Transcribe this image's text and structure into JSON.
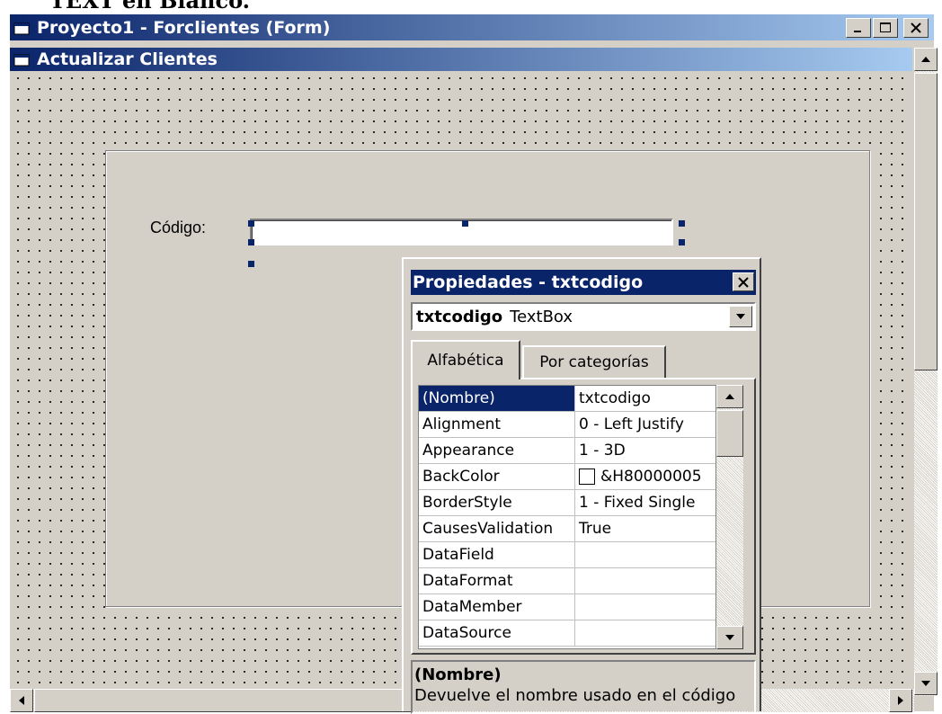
{
  "cropped_caption": "TEXT en Blanco.",
  "window": {
    "title": "Proyecto1 - Forclientes (Form)",
    "minimize": "_",
    "close": "×"
  },
  "form": {
    "caption": "Actualizar Clientes",
    "codigo_label": "Código:",
    "textbox_value": ""
  },
  "properties": {
    "title": "Propiedades - txtcodigo",
    "object_name": "txtcodigo",
    "object_type": "TextBox",
    "tabs": [
      "Alfabética",
      "Por categorías"
    ],
    "rows": [
      {
        "name": "(Nombre)",
        "value": "txtcodigo"
      },
      {
        "name": "Alignment",
        "value": "0 - Left Justify"
      },
      {
        "name": "Appearance",
        "value": "1 - 3D"
      },
      {
        "name": "BackColor",
        "value": "&H80000005"
      },
      {
        "name": "BorderStyle",
        "value": "1 - Fixed Single"
      },
      {
        "name": "CausesValidation",
        "value": "True"
      },
      {
        "name": "DataField",
        "value": ""
      },
      {
        "name": "DataFormat",
        "value": ""
      },
      {
        "name": "DataMember",
        "value": ""
      },
      {
        "name": "DataSource",
        "value": ""
      }
    ],
    "description_title": "(Nombre)",
    "description_text": "Devuelve el nombre usado en el código"
  },
  "colors": {
    "titlebar_active": "#0a246a",
    "titlebar_gradient_end": "#a6caf0",
    "face": "#d4d0c8",
    "selection": "#0a246a"
  }
}
